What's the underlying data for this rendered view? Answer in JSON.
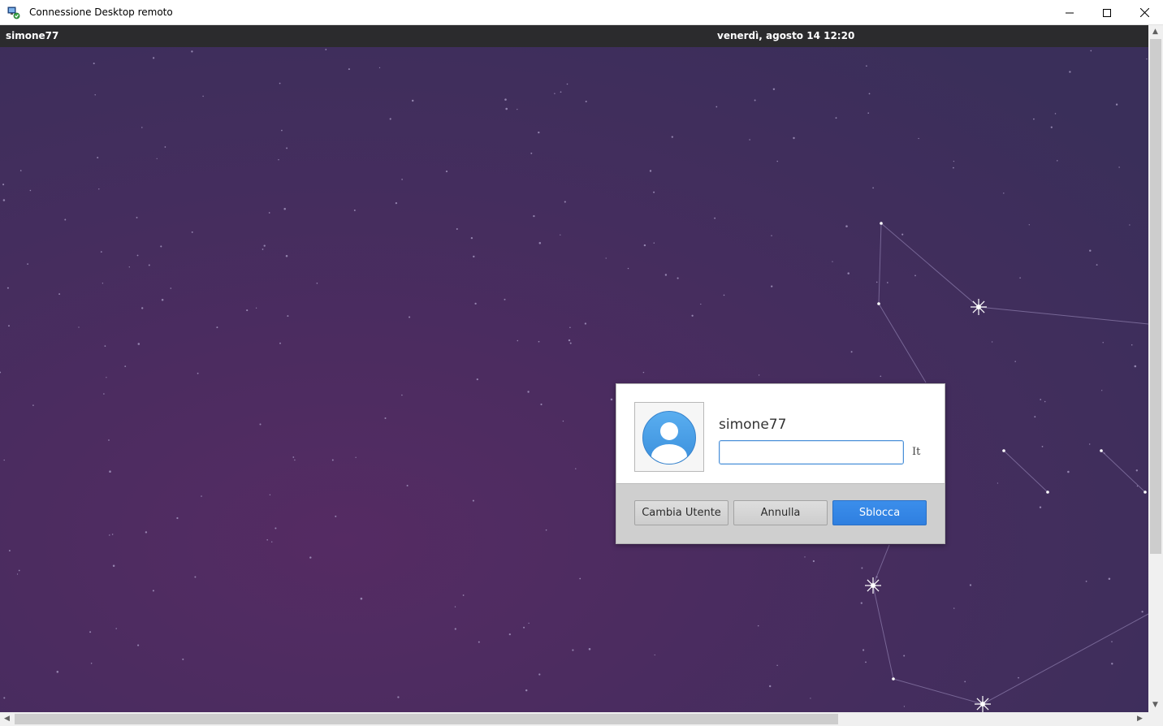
{
  "window": {
    "title": "Connessione Desktop remoto",
    "icon": "remote-desktop-icon",
    "controls": [
      "minimize-icon",
      "maximize-icon",
      "close-icon"
    ]
  },
  "panel": {
    "user": "simone77",
    "clock": "venerdì, agosto 14   12:20"
  },
  "lock_dialog": {
    "username": "simone77",
    "password_value": "",
    "keyboard_layout": "It",
    "buttons": {
      "switch_user": "Cambia Utente",
      "cancel": "Annulla",
      "unlock": "Sblocca"
    }
  },
  "colors": {
    "desktop_bg": "#4a2c5e",
    "panel_bg": "#2b2b2d",
    "accent": "#2f7fe0"
  }
}
